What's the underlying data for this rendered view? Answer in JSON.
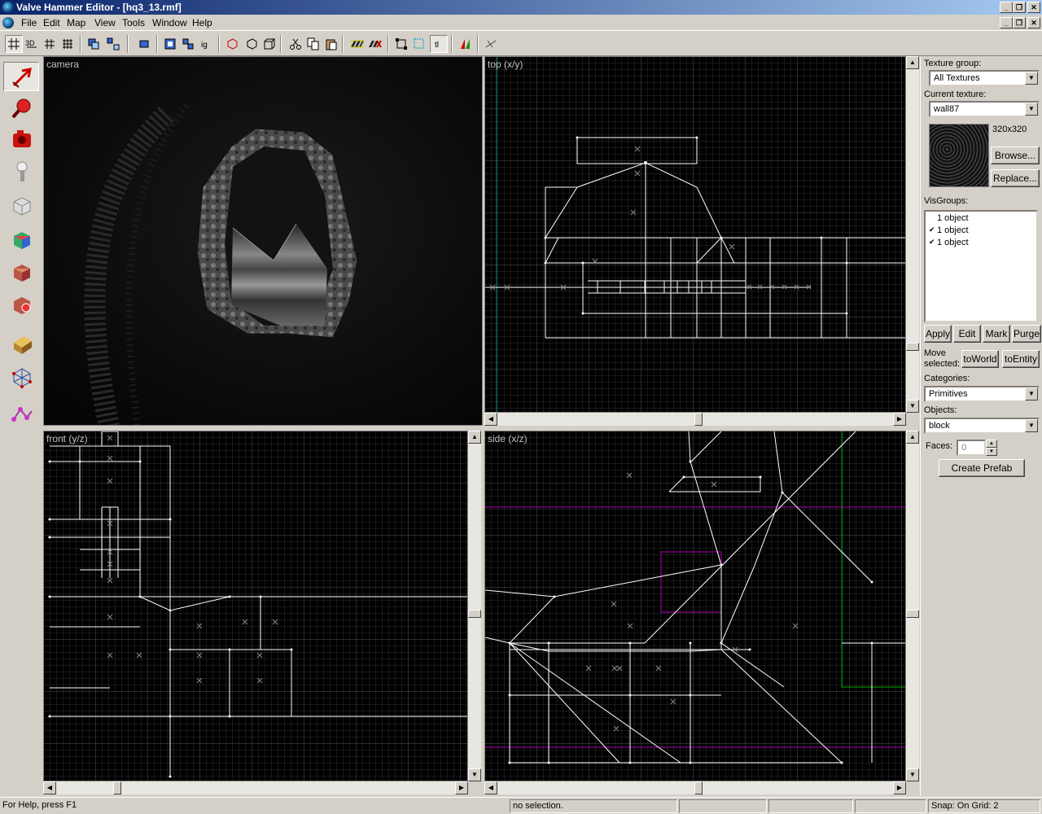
{
  "window": {
    "title": "Valve Hammer Editor - [hq3_13.rmf]"
  },
  "menu": [
    {
      "label": "File"
    },
    {
      "label": "Edit"
    },
    {
      "label": "Map"
    },
    {
      "label": "View"
    },
    {
      "label": "Tools"
    },
    {
      "label": "Window"
    },
    {
      "label": "Help"
    }
  ],
  "viewports": {
    "camera": "camera",
    "top": "top (x/y)",
    "front": "front (y/z)",
    "side": "side (x/z)"
  },
  "panel": {
    "texture_group_label": "Texture group:",
    "texture_group_value": "All Textures",
    "current_texture_label": "Current texture:",
    "current_texture_value": "wall87",
    "texture_size": "320x320",
    "browse": "Browse...",
    "replace": "Replace...",
    "visgroups_label": "VisGroups:",
    "visgroups": [
      {
        "label": "1 object",
        "visible": false
      },
      {
        "label": "1 object",
        "visible": true
      },
      {
        "label": "1 object",
        "visible": true
      }
    ],
    "apply": "Apply",
    "edit": "Edit",
    "mark": "Mark",
    "purge": "Purge",
    "move_selected_label_1": "Move",
    "move_selected_label_2": "selected:",
    "to_world": "toWorld",
    "to_entity": "toEntity",
    "categories_label": "Categories:",
    "categories_value": "Primitives",
    "objects_label": "Objects:",
    "objects_value": "block",
    "faces_label": "Faces:",
    "faces_value": "0",
    "create_prefab": "Create Prefab"
  },
  "status": {
    "help": "For Help, press F1",
    "selection": "no selection.",
    "snap": "Snap: On Grid: 2"
  },
  "colors": {
    "grid_minor": "#2f2f2f",
    "grid_major": "#555555",
    "brush": "#ffffff",
    "magenta": "#b000b0",
    "green": "#00b000",
    "teal": "#0d8a8a"
  }
}
